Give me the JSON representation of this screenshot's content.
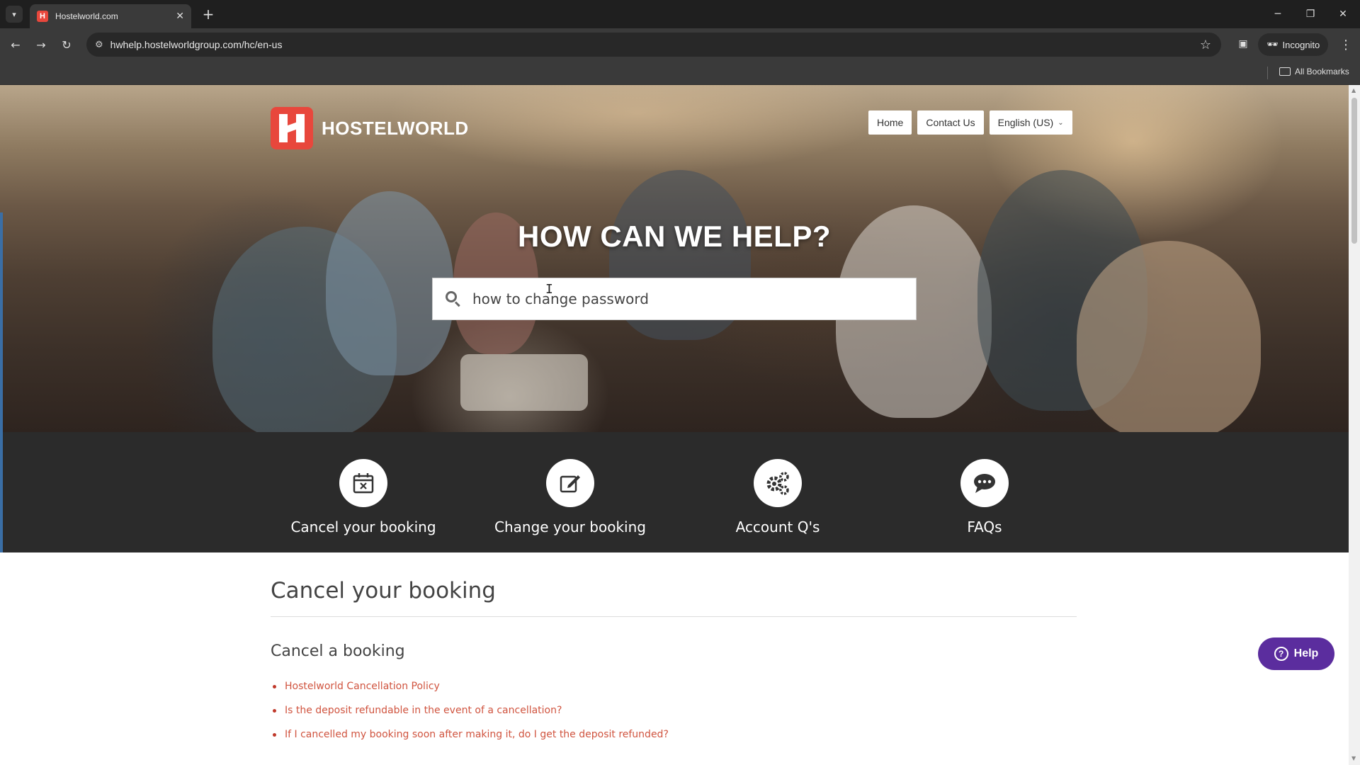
{
  "browser": {
    "tab_title": "Hostelworld.com",
    "tab_favicon_letter": "H",
    "url": "hwhelp.hostelworldgroup.com/hc/en-us",
    "incognito_label": "Incognito",
    "all_bookmarks_label": "All Bookmarks"
  },
  "hero": {
    "logo_text": "HOSTELWORLD",
    "nav": {
      "home": "Home",
      "contact": "Contact Us",
      "language": "English (US)"
    },
    "title": "HOW CAN WE HELP?",
    "search_value": "how to change password"
  },
  "categories": [
    {
      "label": "Cancel your booking",
      "icon": "calendar-x-icon"
    },
    {
      "label": "Change your booking",
      "icon": "edit-icon"
    },
    {
      "label": "Account Q's",
      "icon": "gears-icon"
    },
    {
      "label": "FAQs",
      "icon": "chat-bubble-icon"
    }
  ],
  "content": {
    "section_title": "Cancel your booking",
    "subsection_title": "Cancel a booking",
    "articles": [
      "Hostelworld Cancellation Policy",
      "Is the deposit refundable in the event of a cancellation?",
      "If I cancelled my booking soon after making it, do I get the deposit refunded?"
    ]
  },
  "help_button": {
    "label": "Help"
  },
  "colors": {
    "brand_red": "#e8473c",
    "link": "#d0543f",
    "band": "#2b2b2b",
    "help_purple": "#5b2d9e"
  }
}
